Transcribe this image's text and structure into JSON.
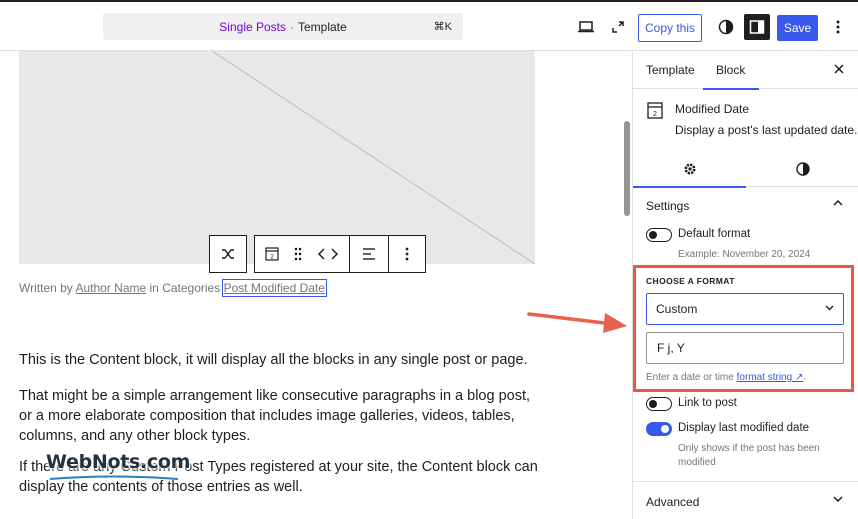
{
  "header": {
    "doc_title": "Single Posts",
    "separator": "·",
    "doc_kind": "Template",
    "shortcut": "⌘K",
    "copy_label": "Copy this",
    "save_label": "Save"
  },
  "canvas": {
    "byline": {
      "prefix": "Written by",
      "author": "Author Name",
      "middle": "in Categories",
      "modified": "Post Modified Date"
    },
    "paragraphs": [
      "This is the Content block, it will display all the blocks in any single post or page.",
      "That might be a simple arrangement like consecutive paragraphs in a blog post, or a more elaborate composition that includes image galleries, videos, tables, columns, and any other block types.",
      "If there are any Custom Post Types registered at your site, the Content block can display the contents of those entries as well."
    ],
    "watermark": "WebNots.com"
  },
  "sidebar": {
    "tabs": [
      "Template",
      "Block"
    ],
    "active_tab": "Block",
    "block": {
      "title": "Modified Date",
      "description": "Display a post's last updated date.",
      "icon_digit": "2"
    },
    "settings": {
      "title": "Settings",
      "default_format": {
        "label": "Default format",
        "example": "Example: November 20, 2024",
        "enabled": false
      },
      "choose_format_label": "CHOOSE A FORMAT",
      "format_select": "Custom",
      "format_string": "F j, Y",
      "format_help_prefix": "Enter a date or time",
      "format_help_link": "format string ↗",
      "format_help_suffix": ".",
      "link_to_post": {
        "label": "Link to post",
        "enabled": false
      },
      "last_modified": {
        "label": "Display last modified date",
        "help": "Only shows if the post has been modified",
        "enabled": true
      }
    },
    "advanced_title": "Advanced"
  },
  "colors": {
    "accent": "#3858e9",
    "template_title": "#7a00df",
    "highlight_box": "#e65a4a",
    "arrow": "#e8604f"
  }
}
